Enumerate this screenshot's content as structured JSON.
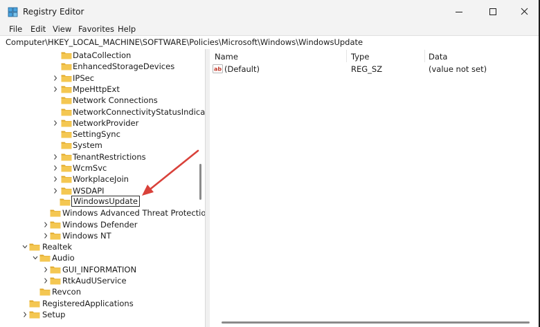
{
  "window": {
    "title": "Registry Editor",
    "minimize_glyph": "–",
    "maximize_glyph": "□",
    "close_glyph": "✕"
  },
  "menu": {
    "items": [
      {
        "label": "File"
      },
      {
        "label": "Edit"
      },
      {
        "label": "View"
      },
      {
        "label": "Favorites"
      },
      {
        "label": "Help"
      }
    ]
  },
  "address": {
    "path": "Computer\\HKEY_LOCAL_MACHINE\\SOFTWARE\\Policies\\Microsoft\\Windows\\WindowsUpdate"
  },
  "tree": {
    "items": [
      {
        "label": "DataCollection",
        "expander": "none"
      },
      {
        "label": "EnhancedStorageDevices",
        "expander": "none"
      },
      {
        "label": "IPSec",
        "expander": "collapsed"
      },
      {
        "label": "MpeHttpExt",
        "expander": "collapsed"
      },
      {
        "label": "Network Connections",
        "expander": "none"
      },
      {
        "label": "NetworkConnectivityStatusIndicator",
        "expander": "none"
      },
      {
        "label": "NetworkProvider",
        "expander": "collapsed"
      },
      {
        "label": "SettingSync",
        "expander": "none"
      },
      {
        "label": "System",
        "expander": "none"
      },
      {
        "label": "TenantRestrictions",
        "expander": "collapsed"
      },
      {
        "label": "WcmSvc",
        "expander": "collapsed"
      },
      {
        "label": "WorkplaceJoin",
        "expander": "collapsed"
      },
      {
        "label": "WSDAPI",
        "expander": "collapsed"
      },
      {
        "label": "WindowsUpdate",
        "expander": "none",
        "editing": true
      },
      {
        "label": "Windows Advanced Threat Protection",
        "expander": "none"
      },
      {
        "label": "Windows Defender",
        "expander": "collapsed"
      },
      {
        "label": "Windows NT",
        "expander": "collapsed"
      },
      {
        "label": "Realtek",
        "expander": "expanded"
      },
      {
        "label": "Audio",
        "expander": "expanded"
      },
      {
        "label": "GUI_INFORMATION",
        "expander": "collapsed"
      },
      {
        "label": "RtkAudUService",
        "expander": "collapsed"
      },
      {
        "label": "Revcon",
        "expander": "none"
      },
      {
        "label": "RegisteredApplications",
        "expander": "none"
      },
      {
        "label": "Setup",
        "expander": "collapsed"
      }
    ]
  },
  "values_pane": {
    "columns": {
      "name": "Name",
      "type": "Type",
      "data": "Data"
    },
    "rows": [
      {
        "name": "(Default)",
        "type": "REG_SZ",
        "data": "(value not set)",
        "icon": "string-value-icon",
        "icon_text": "ab"
      }
    ]
  },
  "colors": {
    "folder": "#f4c752",
    "folder_dark": "#e0a92c",
    "annotation_arrow": "#d9413a",
    "value_icon": "#c0392b"
  }
}
